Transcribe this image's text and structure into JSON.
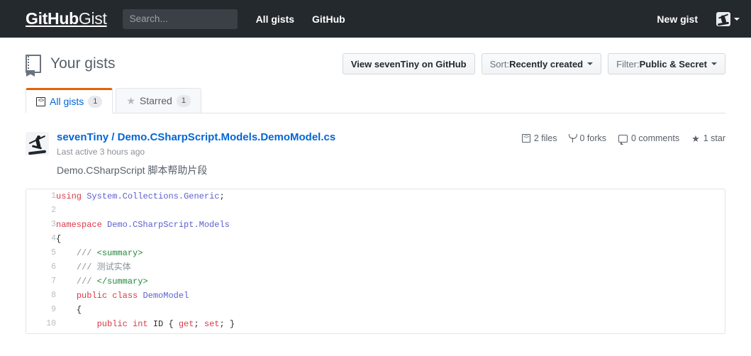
{
  "header": {
    "logo_strong": "GitHub",
    "logo_light": "Gist",
    "search_placeholder": "Search...",
    "nav": [
      {
        "label": "All gists"
      },
      {
        "label": "GitHub"
      }
    ],
    "new_gist_label": "New gist",
    "avatar_name": "user-avatar"
  },
  "page": {
    "title": "Your gists",
    "buttons": [
      {
        "name": "view-on-github-button",
        "label": "View sevenTiny on GitHub",
        "has_caret": false
      },
      {
        "name": "sort-button",
        "prefix": "Sort: ",
        "label": "Recently created",
        "has_caret": true
      },
      {
        "name": "filter-button",
        "prefix": "Filter: ",
        "label": "Public & Secret",
        "has_caret": true
      }
    ]
  },
  "tabs": [
    {
      "name": "tab-all-gists",
      "label": "All gists",
      "count": "1",
      "active": true,
      "icon": "code-icon"
    },
    {
      "name": "tab-starred",
      "label": "Starred",
      "count": "1",
      "active": false,
      "icon": "star-icon"
    }
  ],
  "gist": {
    "owner": "sevenTiny",
    "separator": " / ",
    "filename": "Demo.CSharpScript.Models.DemoModel.cs",
    "last_active": "Last active 3 hours ago",
    "description": "Demo.CSharpScript 脚本帮助片段",
    "meta": {
      "files": "2 files",
      "forks": "0 forks",
      "comments": "0 comments",
      "stars": "1 star"
    }
  },
  "code": {
    "language": "csharp",
    "lines": [
      {
        "n": "1",
        "text": "using System.Collections.Generic;"
      },
      {
        "n": "2",
        "text": ""
      },
      {
        "n": "3",
        "text": "namespace Demo.CSharpScript.Models"
      },
      {
        "n": "4",
        "text": "{"
      },
      {
        "n": "5",
        "text": "    /// <summary>"
      },
      {
        "n": "6",
        "text": "    /// 测试实体"
      },
      {
        "n": "7",
        "text": "    /// </summary>"
      },
      {
        "n": "8",
        "text": "    public class DemoModel"
      },
      {
        "n": "9",
        "text": "    {"
      },
      {
        "n": "10",
        "text": "        public int ID { get; set; }"
      }
    ]
  },
  "colors": {
    "header_bg": "#24292e",
    "link_blue": "#0366d6",
    "tab_accent_orange": "#e36209",
    "keyword_red": "#d73a49",
    "identifier_blue": "#5b5fcf",
    "comment_gray": "#8a9199",
    "tag_green": "#22863a",
    "muted_text": "#586069"
  }
}
